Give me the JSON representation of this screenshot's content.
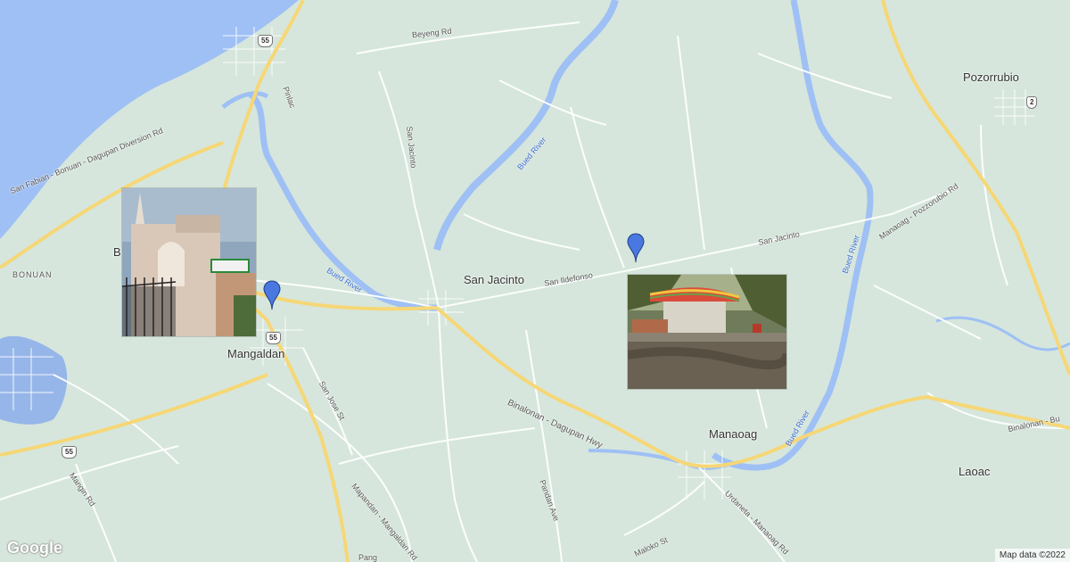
{
  "map": {
    "attribution": "Map data ©2022",
    "logo": "Google",
    "colors": {
      "land": "#d6e6dc",
      "water": "#9fc0f5",
      "highway": "#f6d776",
      "road": "#ffffff",
      "river": "#9fc0f5",
      "marker": "#4a78e0"
    },
    "towns": [
      {
        "name": "Pozorrubio",
        "key": "pozorrubio"
      },
      {
        "name": "San Jacinto",
        "key": "san-jacinto"
      },
      {
        "name": "Mangaldan",
        "key": "mangaldan"
      },
      {
        "name": "Manaoag",
        "key": "manaoag"
      },
      {
        "name": "Laoac",
        "key": "laoac"
      },
      {
        "name": "BONUAN",
        "key": "bonuan"
      },
      {
        "name": "B",
        "key": "b"
      }
    ],
    "roads": {
      "beyeng": "Beyeng Rd",
      "pinlac": "Pinlac",
      "san_jacinto_rd": "San Jacinto",
      "san_jacinto_top": "San Jacinto",
      "diversion": "San Fabian - Bonuan - Dagupan Diversion Rd",
      "san_ildefonso": "San Ildefonso",
      "manaoag_pozorrubio": "Manaoag - Pozzorubio Rd",
      "binalonan_dagupan": "Binalonan - Dagupan Hwy",
      "binalonan_right": "Binalonan - Bu",
      "san_jose": "San Jose St",
      "mapandan": "Mapandan - Mangaldan Rd",
      "pandan": "Pandan Ave",
      "urdaneta": "Urdaneta - Manaoag Rd",
      "maloko": "Maloko St",
      "mangin": "Mangin Rd",
      "pang": "Pang"
    },
    "rivers": {
      "bued_1": "Bued River",
      "bued_2": "Bued River",
      "bued_3": "Bued River",
      "bued_4": "Bued River"
    },
    "shields": {
      "r55_top": "55",
      "r55_mid": "55",
      "r55_left": "55",
      "r2": "2"
    },
    "markers": [
      {
        "name": "Mangaldan church"
      },
      {
        "name": "San Jacinto site"
      }
    ]
  }
}
